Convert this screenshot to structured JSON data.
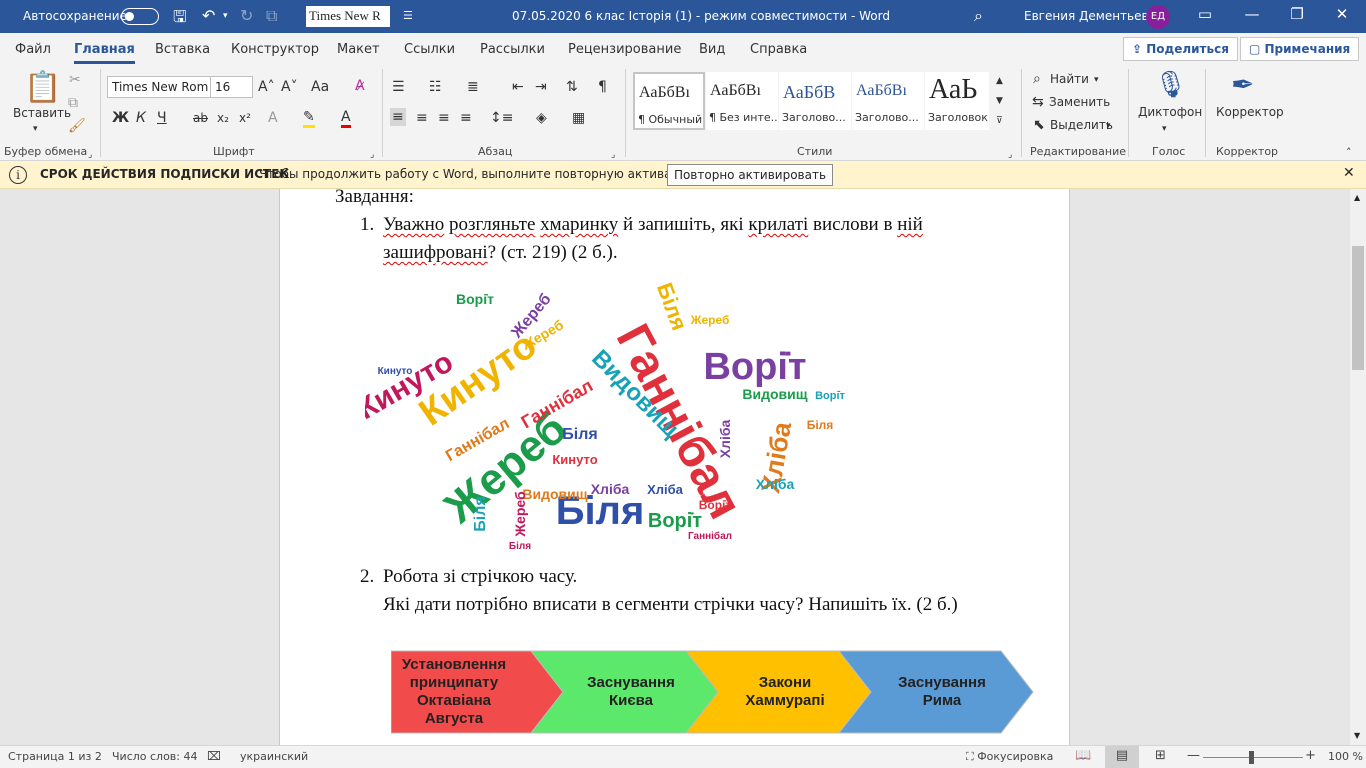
{
  "titlebar": {
    "autosave_label": "Автосохранение",
    "font_box": "Times New R",
    "doc_title": "07.05.2020 6 клас Історія (1)  -  режим совместимости  -  Word",
    "user_name": "Евгения Дементьева",
    "user_initials": "ЕД"
  },
  "tabs": [
    "Файл",
    "Главная",
    "Вставка",
    "Конструктор",
    "Макет",
    "Ссылки",
    "Рассылки",
    "Рецензирование",
    "Вид",
    "Справка"
  ],
  "share": {
    "share_label": "Поделиться",
    "comments_label": "Примечания"
  },
  "ribbon": {
    "clipboard": {
      "paste_label": "Вставить",
      "group": "Буфер обмена"
    },
    "font": {
      "name": "Times New Rom",
      "size": "16",
      "change_case": "Aa",
      "group": "Шрифт",
      "bold": "Ж",
      "italic": "К",
      "underline": "Ч",
      "strike": "ab",
      "sub": "x₂",
      "sup": "x²",
      "grow": "A˄",
      "shrink": "A˅"
    },
    "paragraph": {
      "group": "Абзац"
    },
    "styles": {
      "group": "Стили",
      "items": [
        {
          "preview": "АаБбВı",
          "name": "¶ Обычный"
        },
        {
          "preview": "АаБбВı",
          "name": "¶ Без инте..."
        },
        {
          "preview": "АаБбВ",
          "name": "Заголово..."
        },
        {
          "preview": "АаБбВı",
          "name": "Заголово..."
        },
        {
          "preview": "АаЬ",
          "name": "Заголовок"
        }
      ]
    },
    "editing": {
      "find": "Найти",
      "replace": "Заменить",
      "select": "Выделить",
      "group": "Редактирование"
    },
    "voice": {
      "dictate": "Диктофон",
      "group": "Голос"
    },
    "editor": {
      "label": "Корректор",
      "group": "Корректор"
    }
  },
  "message_bar": {
    "title": "СРОК ДЕЙСТВИЯ ПОДПИСКИ ИСТЕК",
    "text": "Чтобы продолжить работу с Word, выполните повторную активацию.",
    "button": "Повторно активировать"
  },
  "document": {
    "heading": "Завдання:",
    "task1_num": "1.",
    "task1_line1_a": "Уважно",
    "task1_line1_b": "розгляньте",
    "task1_line1_c": "хмаринку",
    "task1_line1_d": "й запишіть, які",
    "task1_line1_e": "крилаті",
    "task1_line1_f": "вислови в",
    "task1_line1_g": "ній",
    "task1_line2_a": "зашифровані",
    "task1_line2_b": "? (ст. 219) (2 б.).",
    "task2_num": "2.",
    "task2_line1": "Робота зі стрічкою часу.",
    "task2_line2": "Які дати потрібно вписати в сегменти стрічки часу? Напишіть їх. (2 б.)",
    "word_cloud": {
      "words": [
        "Ганнібал",
        "Біля",
        "Жереб",
        "Кинуто",
        "Ворі̇т",
        "Хліба",
        "Видовищ",
        "Кинуто",
        "Ганнібал",
        "Біля",
        "Ворі̇т",
        "Жереб",
        "Хліба",
        "Видовищ",
        "Біля",
        "Жереб",
        "Кинуто",
        "Хліба",
        "Ворі̇т",
        "Біля",
        "Жереб",
        "Ганнібал",
        "Хліба",
        "Біля",
        "Ворі̇т",
        "Кинуто",
        "Видовищ",
        "Жереб",
        "Хліба",
        "Біля",
        "Ворі̇т",
        "Ганнібал"
      ]
    },
    "timeline": [
      {
        "text": "Установлення принципату Октавіана Августа",
        "color": "#f24b4b"
      },
      {
        "text": "Заснування Києва",
        "color": "#5ce86a"
      },
      {
        "text": "Закони Хаммурапі",
        "color": "#ffc000"
      },
      {
        "text": "Заснування Рима",
        "color": "#5b9bd5"
      }
    ]
  },
  "status": {
    "page": "Страница 1 из 2",
    "words": "Число слов: 44",
    "language": "украинский",
    "focus": "Фокусировка",
    "zoom": "100 %"
  },
  "colors": {
    "word_blue": "#2b579a",
    "message_bg": "#fff4ce"
  }
}
